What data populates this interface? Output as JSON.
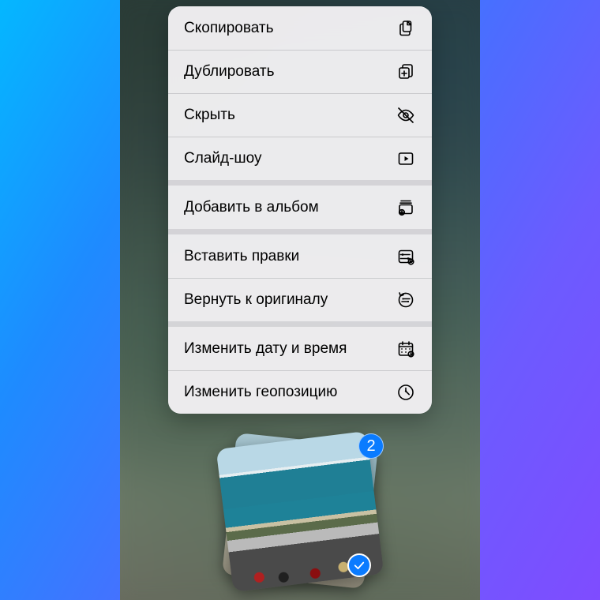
{
  "menu": {
    "groups": [
      {
        "items": [
          {
            "id": "copy",
            "label": "Скопировать",
            "icon": "copy-icon"
          },
          {
            "id": "duplicate",
            "label": "Дублировать",
            "icon": "duplicate-icon"
          },
          {
            "id": "hide",
            "label": "Скрыть",
            "icon": "hide-icon"
          },
          {
            "id": "slideshow",
            "label": "Слайд-шоу",
            "icon": "slideshow-icon"
          }
        ]
      },
      {
        "items": [
          {
            "id": "addalbum",
            "label": "Добавить в альбом",
            "icon": "add-album-icon"
          }
        ]
      },
      {
        "items": [
          {
            "id": "paste",
            "label": "Вставить правки",
            "icon": "paste-edits-icon"
          },
          {
            "id": "revert",
            "label": "Вернуть к оригиналу",
            "icon": "revert-icon"
          }
        ]
      },
      {
        "items": [
          {
            "id": "editdate",
            "label": "Изменить дату и время",
            "icon": "calendar-icon"
          },
          {
            "id": "editloc",
            "label": "Изменить геопозицию",
            "icon": "location-icon"
          }
        ]
      }
    ]
  },
  "selection": {
    "count": "2"
  },
  "colors": {
    "accent": "#0a7bff"
  }
}
